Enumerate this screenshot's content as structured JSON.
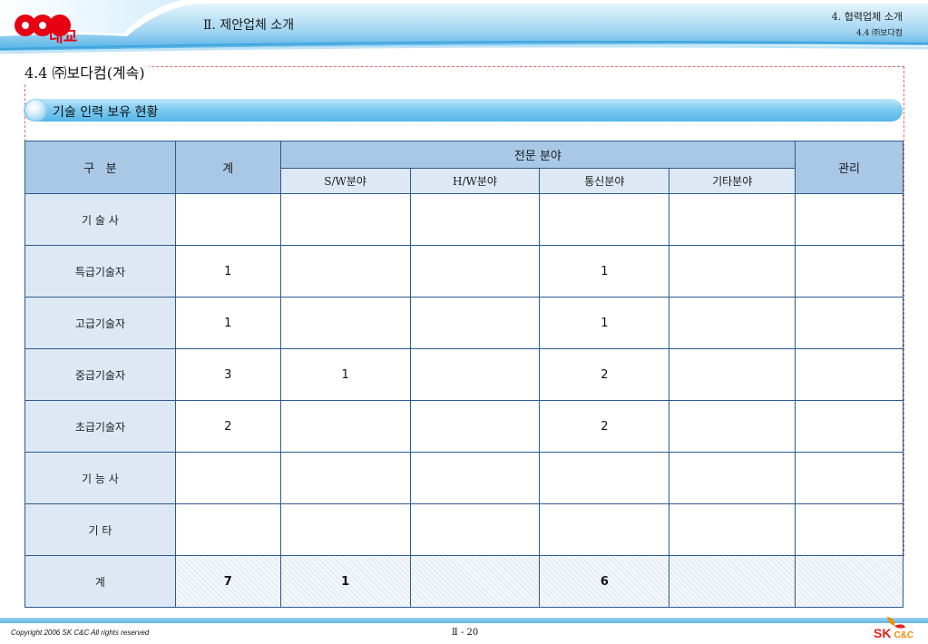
{
  "header": {
    "logo_text": "대교",
    "title": "Ⅱ. 제안업체 소개",
    "section_path": "4. 협력업체 소개",
    "subsection_path": "4.4 ㈜보다컴"
  },
  "page_title": "4.4 ㈜보다컴(계속)",
  "section_label": "기술 인력 보유 현황",
  "table": {
    "headers": {
      "category": "구   분",
      "total": "계",
      "specialty": "전문 분야",
      "management": "관리",
      "sub": [
        "S/W분야",
        "H/W분야",
        "통신분야",
        "기타분야"
      ]
    },
    "rows": [
      {
        "label": "기 술 사",
        "total": "",
        "sw": "",
        "hw": "",
        "comm": "",
        "etc": "",
        "mgmt": ""
      },
      {
        "label": "특급기술자",
        "total": "1",
        "sw": "",
        "hw": "",
        "comm": "1",
        "etc": "",
        "mgmt": ""
      },
      {
        "label": "고급기술자",
        "total": "1",
        "sw": "",
        "hw": "",
        "comm": "1",
        "etc": "",
        "mgmt": ""
      },
      {
        "label": "중급기술자",
        "total": "3",
        "sw": "1",
        "hw": "",
        "comm": "2",
        "etc": "",
        "mgmt": ""
      },
      {
        "label": "초급기술자",
        "total": "2",
        "sw": "",
        "hw": "",
        "comm": "2",
        "etc": "",
        "mgmt": ""
      },
      {
        "label": "기 능 사",
        "total": "",
        "sw": "",
        "hw": "",
        "comm": "",
        "etc": "",
        "mgmt": ""
      },
      {
        "label": "기 타",
        "total": "",
        "sw": "",
        "hw": "",
        "comm": "",
        "etc": "",
        "mgmt": ""
      },
      {
        "label": "계",
        "total": "7",
        "sw": "1",
        "hw": "",
        "comm": "6",
        "etc": "",
        "mgmt": ""
      }
    ]
  },
  "footer": {
    "copyright": "Copyright 2006 SK C&C All rights reserved",
    "page_number": "Ⅱ - 20",
    "brand_sk": "SK",
    "brand_cc": "C&C"
  },
  "colors": {
    "header_blue": "#55b6e8",
    "table_border": "#2c5a8f",
    "table_header": "#a9c8e6",
    "row_header": "#dde8f4",
    "logo_red": "#e60012"
  }
}
